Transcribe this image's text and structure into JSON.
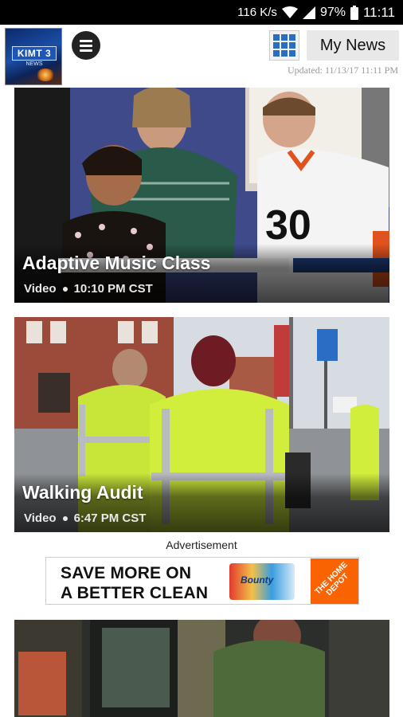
{
  "status_bar": {
    "speed": "116 K/s",
    "battery": "97%",
    "time": "11:11"
  },
  "app_bar": {
    "logo_text": "KIMT 3",
    "logo_sub": "NEWS",
    "my_news_label": "My News",
    "updated_text": "Updated: 11/13/17 11:11 PM"
  },
  "stories": [
    {
      "title": "Adaptive Music Class",
      "type": "Video",
      "time": "10:10 PM CST"
    },
    {
      "title": "Walking Audit",
      "type": "Video",
      "time": "6:47 PM CST"
    }
  ],
  "ad": {
    "label": "Advertisement",
    "headline_line1": "SAVE MORE ON",
    "headline_line2": "A BETTER CLEAN",
    "product_text": "Bounty",
    "brand_text": "THE HOME DEPOT"
  },
  "colors": {
    "accent_blue": "#2a6dc4",
    "home_depot_orange": "#f96302"
  }
}
